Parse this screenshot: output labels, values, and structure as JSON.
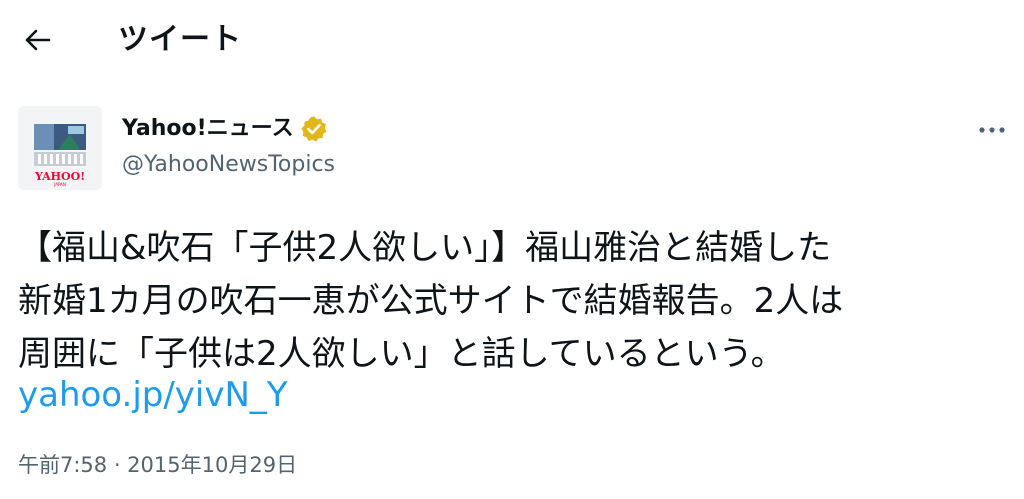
{
  "header": {
    "title": "ツイート",
    "back_icon": "arrow-left-icon"
  },
  "author": {
    "name": "Yahoo!ニュース",
    "handle": "@YahooNewsTopics",
    "verified": true,
    "badge_color": "#e2b719",
    "avatar_logo_text": "YAHOO!",
    "avatar_logo_subtext": "JAPAN",
    "avatar_logo_color": "#ff0033"
  },
  "tweet": {
    "lines": [
      "【福山&吹石「子供2人欲しい」】福山雅治と結婚した",
      "新婚1カ月の吹石一恵が公式サイトで結婚報告。2人は",
      "周囲に「子供は2人欲しい」と話しているという。"
    ],
    "link": "yahoo.jp/yivN_Y",
    "timestamp": "午前7:58 · 2015年10月29日"
  },
  "colors": {
    "text": "#0f1419",
    "secondary": "#536471",
    "link": "#1d9bf0"
  },
  "icons": {
    "more": "more-horizontal-icon",
    "verified": "verified-badge-icon"
  }
}
